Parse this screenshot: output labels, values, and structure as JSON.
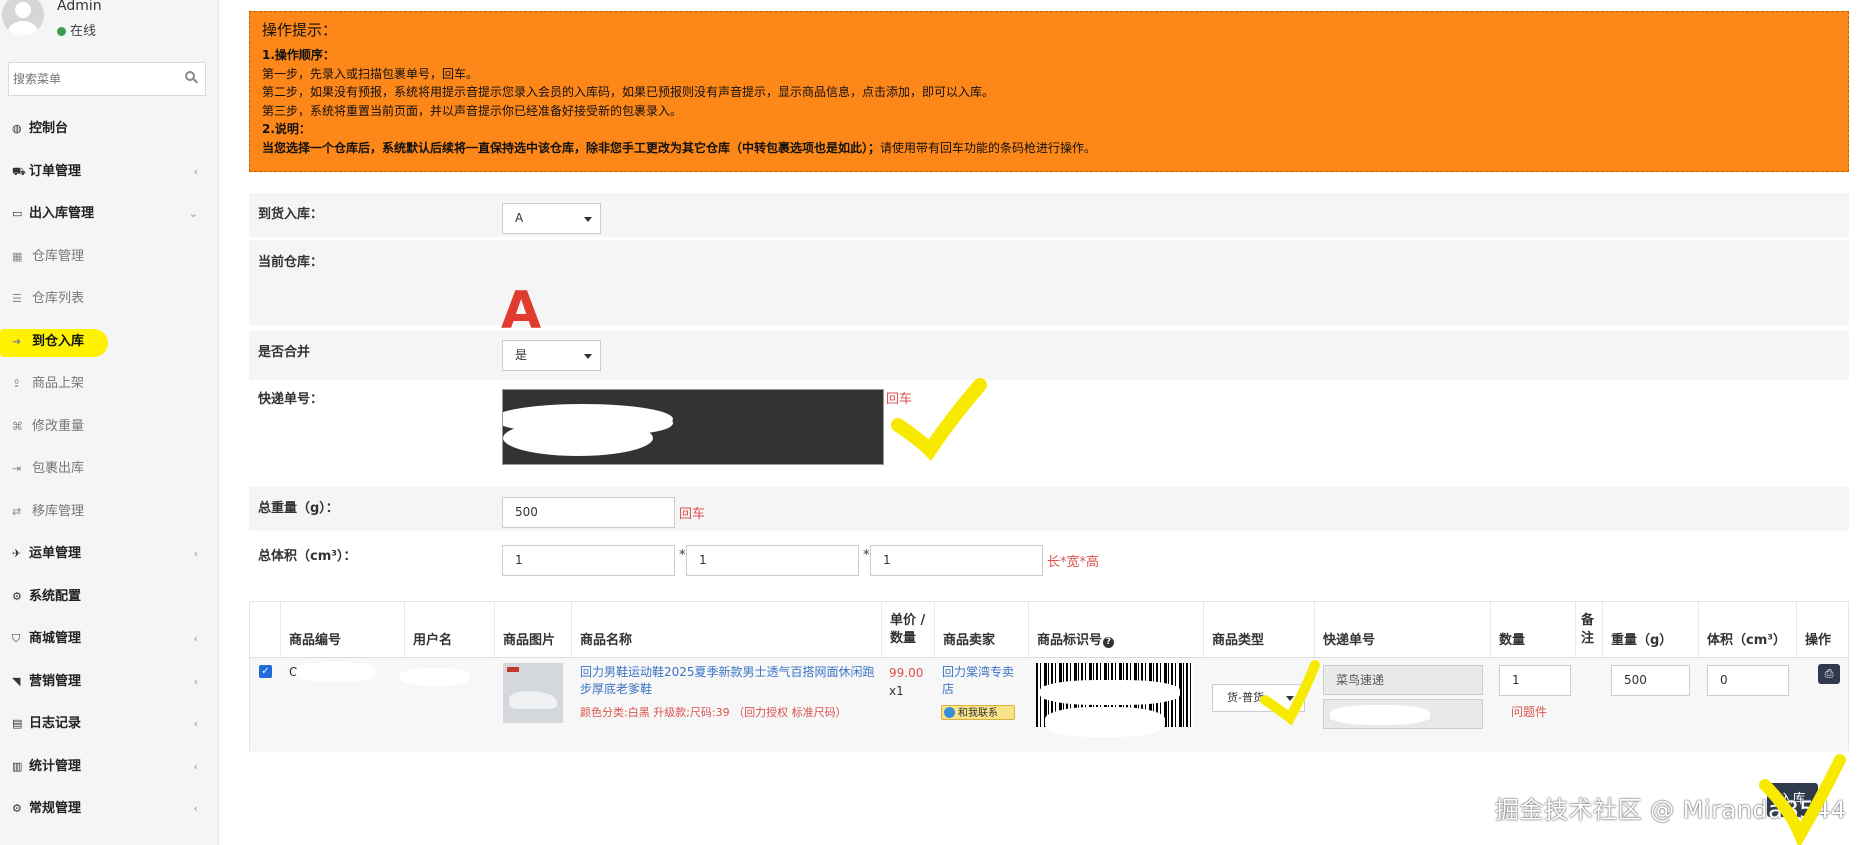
{
  "user": {
    "name": "Admin",
    "status": "在线"
  },
  "search": {
    "placeholder": "搜索菜单"
  },
  "menu": [
    {
      "label": "控制台",
      "icon": "dashboard-icon",
      "glyph": "◍",
      "type": "top",
      "chevron": ""
    },
    {
      "label": "订单管理",
      "icon": "cart-icon",
      "glyph": "⛟",
      "type": "top",
      "chevron": "‹"
    },
    {
      "label": "出入库管理",
      "icon": "inbox-icon",
      "glyph": "▭",
      "type": "top",
      "chevron": "⌄"
    },
    {
      "label": "仓库管理",
      "icon": "table-icon",
      "glyph": "▦",
      "type": "sub",
      "chevron": ""
    },
    {
      "label": "仓库列表",
      "icon": "list-icon",
      "glyph": "☰",
      "type": "sub",
      "chevron": ""
    },
    {
      "label": "到仓入库",
      "icon": "sign-in-icon",
      "glyph": "➜",
      "type": "sub active",
      "chevron": ""
    },
    {
      "label": "商品上架",
      "icon": "upload-icon",
      "glyph": "⇪",
      "type": "sub",
      "chevron": ""
    },
    {
      "label": "修改重量",
      "icon": "edit-weight-icon",
      "glyph": "⌘",
      "type": "sub",
      "chevron": ""
    },
    {
      "label": "包裹出库",
      "icon": "sign-out-icon",
      "glyph": "⇥",
      "type": "sub",
      "chevron": ""
    },
    {
      "label": "移库管理",
      "icon": "exchange-icon",
      "glyph": "⇄",
      "type": "sub",
      "chevron": ""
    },
    {
      "label": "运单管理",
      "icon": "plane-icon",
      "glyph": "✈",
      "type": "top",
      "chevron": "‹"
    },
    {
      "label": "系统配置",
      "icon": "gear-icon",
      "glyph": "⚙",
      "type": "top",
      "chevron": ""
    },
    {
      "label": "商城管理",
      "icon": "shop-icon",
      "glyph": "⛉",
      "type": "top",
      "chevron": "‹"
    },
    {
      "label": "营销管理",
      "icon": "bullhorn-icon",
      "glyph": "◥",
      "type": "top",
      "chevron": "‹"
    },
    {
      "label": "日志记录",
      "icon": "book-icon",
      "glyph": "▤",
      "type": "top",
      "chevron": "‹"
    },
    {
      "label": "统计管理",
      "icon": "bar-chart-icon",
      "glyph": "▥",
      "type": "top",
      "chevron": "‹"
    },
    {
      "label": "常规管理",
      "icon": "cogs-icon",
      "glyph": "⚙",
      "type": "top",
      "chevron": "‹"
    }
  ],
  "notice": {
    "title": "操作提示：",
    "h1": "1.操作顺序：",
    "s1": "第一步，先录入或扫描包裹单号，回车。",
    "s2": "第二步，如果没有预报，系统将用提示音提示您录入会员的入库码，如果已预报则没有声音提示，显示商品信息，点击添加，即可以入库。",
    "s3": "第三步，系统将重置当前页面，并以声音提示你已经准备好接受新的包裹录入。",
    "h2": "2.说明：",
    "note_bold": "当您选择一个仓库后，系统默认后续将一直保持选中该仓库，除非您手工更改为其它仓库（中转包裹选项也是如此）；",
    "note_tail": "请使用带有回车功能的条码枪进行操作。"
  },
  "form": {
    "warehouse_label": "到货入库：",
    "warehouse_value": "A",
    "current_label": "当前仓库：",
    "current_value": "A",
    "merge_label": "是否合并",
    "merge_value": "是",
    "tracking_label": "快递单号：",
    "enter_hint": "回车",
    "weight_label": "总重量（g）：",
    "weight_value": "500",
    "weight_hint": "回车",
    "volume_label": "总体积（cm³）：",
    "len": "1",
    "wid": "1",
    "hei": "1",
    "times": "*",
    "volume_hint": "长*宽*高"
  },
  "table": {
    "headers": {
      "code": "商品编号",
      "user": "用户名",
      "img": "商品图片",
      "name": "商品名称",
      "price1": "单价 /",
      "price2": "数量",
      "seller": "商品卖家",
      "barcode": "商品标识号",
      "type": "商品类型",
      "tracking": "快递单号",
      "qty": "数量",
      "note1": "备",
      "note2": "注",
      "weight": "重量（g）",
      "volume": "体积（cm³）",
      "op": "操作"
    },
    "row": {
      "code": "OG",
      "name": "回力男鞋运动鞋2025夏季新款男士透气百搭网面休闲跑步厚底老爹鞋",
      "spec": "颜色分类:白黑 升级款;尺码:39 （回力授权 标准尺码）",
      "price": "99.00",
      "qty_mult": "x1",
      "seller": "回力棠湾专卖店",
      "contact": "和我联系",
      "type": "货-普货",
      "courier": "菜鸟速递",
      "qty": "1",
      "problem": "问题件",
      "weight": "500",
      "volume": "0"
    }
  },
  "submit_label": "入库",
  "watermark": "掘金技术社区 @ Miranda8544"
}
